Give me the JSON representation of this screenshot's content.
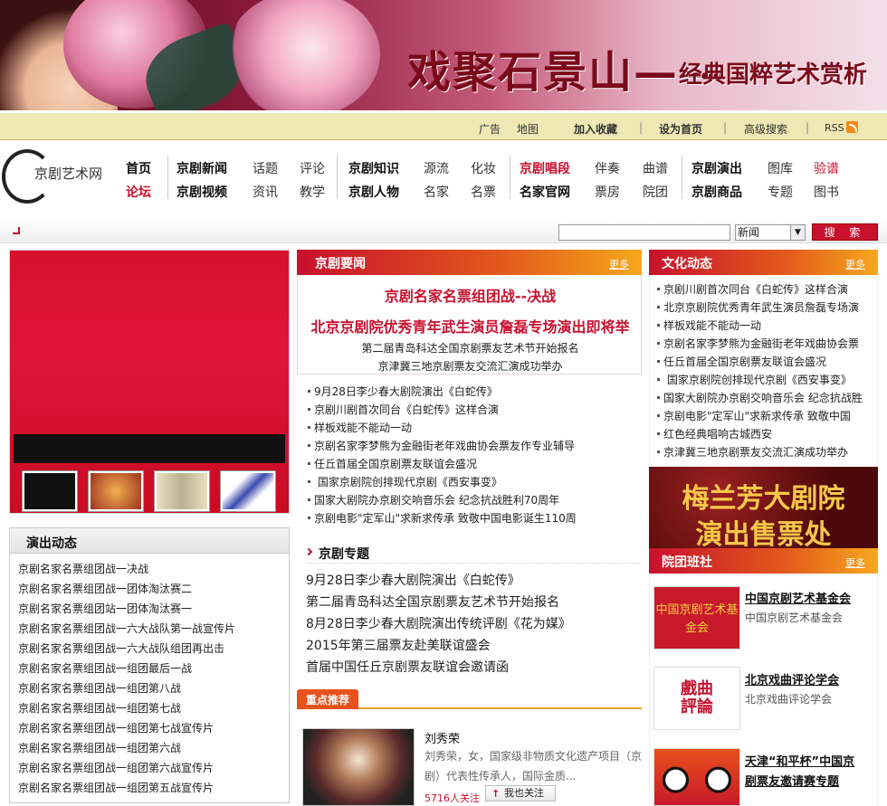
{
  "banner": {
    "title": "戏聚石景山——",
    "subtitle": "经典国粹艺术赏析"
  },
  "topbar": {
    "ad": "广告",
    "map": "地图",
    "favorite": "加入收藏",
    "homepage": "设为首页",
    "advanced_search": "高级搜索",
    "rss": "RSS"
  },
  "logo": {
    "text": "京剧艺术网"
  },
  "nav": {
    "row1": [
      "首页",
      "京剧新闻",
      "话题",
      "评论",
      "京剧知识",
      "源流",
      "化妆",
      "京剧唱段",
      "伴奏",
      "曲谱",
      "京剧演出",
      "图库",
      "验谱"
    ],
    "row2": [
      "论坛",
      "京剧视频",
      "资讯",
      "教学",
      "京剧人物",
      "名家",
      "名票",
      "名家官网",
      "票房",
      "院团",
      "京剧商品",
      "专题",
      "图书"
    ]
  },
  "search": {
    "placeholder": "",
    "select_value": "新闻",
    "button": "搜 索"
  },
  "performance": {
    "title": "演出动态",
    "items": [
      "京剧名家名票组团战一决战",
      "京剧名家名票组团战一团体淘汰赛二",
      "京剧名家名票组团站一团体淘汰赛一",
      "京剧名家名票组团战一六大战队第一战宣传片",
      "京剧名家名票组团战一六大战队组团再出击",
      "京剧名家名票组团战一组团最后一战",
      "京剧名家名票组团战一组团第八战",
      "京剧名家名票组团战一组团第七战",
      "京剧名家名票组团战一组团第七战宣传片",
      "京剧名家名票组团战一组团第六战",
      "京剧名家名票组团战一组团第六战宣传片",
      "京剧名家名票组团战一组团第五战宣传片"
    ]
  },
  "news": {
    "title": "京剧要闻",
    "more": "更多",
    "headline1": "京剧名家名票组团战--决战",
    "headline2": "北京京剧院优秀青年武生演员詹磊专场演出即将举",
    "sub1": "第二届青岛科达全国京剧票友艺术节开始报名",
    "sub2": "京津冀三地京剧票友交流汇演成功举办",
    "items": [
      "9月28日李少春大剧院演出《白蛇传》",
      "京剧川剧首次同台《白蛇传》这样合演",
      "样板戏能不能动一动",
      "京剧名家李梦熊为金融街老年戏曲协会票友作专业辅导",
      "任丘首届全国京剧票友联谊会盛况",
      " 国家京剧院创排现代京剧《西安事变》",
      "国家大剧院办京剧交响音乐会 纪念抗战胜利70周年",
      "京剧电影\"定军山\"求新求传承 致敬中国电影诞生110周"
    ]
  },
  "topics": {
    "title": "京剧专题",
    "items": [
      "9月28日李少春大剧院演出《白蛇传》",
      "第二届青岛科达全国京剧票友艺术节开始报名",
      "8月28日李少春大剧院演出传统评剧《花为媒》",
      "2015年第三届票友赴美联谊盛会",
      "首届中国任丘京剧票友联谊会邀请函"
    ]
  },
  "featured": {
    "tag": "重点推荐",
    "name": "刘秀荣",
    "desc_line1": "刘秀荣，女，国家级非物质文化遗产项目（京",
    "desc_line2": "剧）代表性传承人，国际金质...",
    "fans": "5716人关注",
    "follow_button": "我也关注"
  },
  "culture": {
    "title": "文化动态",
    "more": "更多",
    "items": [
      "京剧川剧首次同台《白蛇传》这样合演",
      "北京京剧院优秀青年武生演员詹磊专场演",
      "样板戏能不能动一动",
      "京剧名家李梦熊为金融街老年戏曲协会票",
      "任丘首届全国京剧票友联谊会盛况",
      " 国家京剧院创排现代京剧《西安事变》",
      "国家大剧院办京剧交响音乐会 纪念抗战胜",
      "京剧电影\"定军山\"求新求传承 致敬中国",
      "红色经典唱响古城西安",
      "京津冀三地京剧票友交流汇演成功举办"
    ]
  },
  "ad": {
    "line1": "梅兰芳大剧院",
    "line2": "演出售票处"
  },
  "troupes": {
    "title": "院团班社",
    "more": "更多",
    "items": [
      {
        "name": "中国京剧艺术基金会",
        "desc": "中国京剧艺术基金会",
        "logo_text": "中国京剧艺术基金会"
      },
      {
        "name": "北京戏曲评论学会",
        "desc": "北京戏曲评论学会",
        "logo_text": "戲曲評論"
      },
      {
        "name": "天津“和平杯”中国京",
        "name2": "剧票友邀请赛专题",
        "desc": "",
        "logo_text": ""
      }
    ]
  },
  "colors": {
    "accent": "#c8102e",
    "topbar": "#efe7b4",
    "orange": "#f7a81d"
  }
}
